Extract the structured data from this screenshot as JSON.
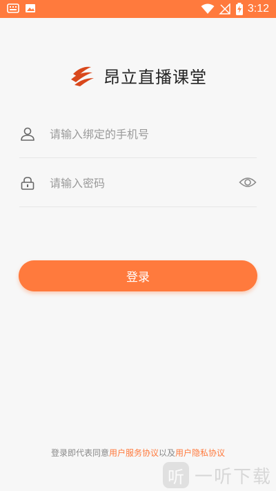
{
  "status_bar": {
    "time": "3:12"
  },
  "brand": {
    "title": "昂立直播课堂"
  },
  "phone_field": {
    "placeholder": "请输入绑定的手机号",
    "value": ""
  },
  "password_field": {
    "placeholder": "请输入密码",
    "value": ""
  },
  "login_button": {
    "label": "登录"
  },
  "agreement": {
    "prefix": "登录即代表同意",
    "service_link": "用户服务协议",
    "conjunction": "以及",
    "privacy_link": "用户隐私协议"
  },
  "watermark": {
    "badge": "听",
    "text": "一听下载"
  },
  "colors": {
    "accent": "#ff7a3d",
    "brand_red": "#d9481c"
  }
}
